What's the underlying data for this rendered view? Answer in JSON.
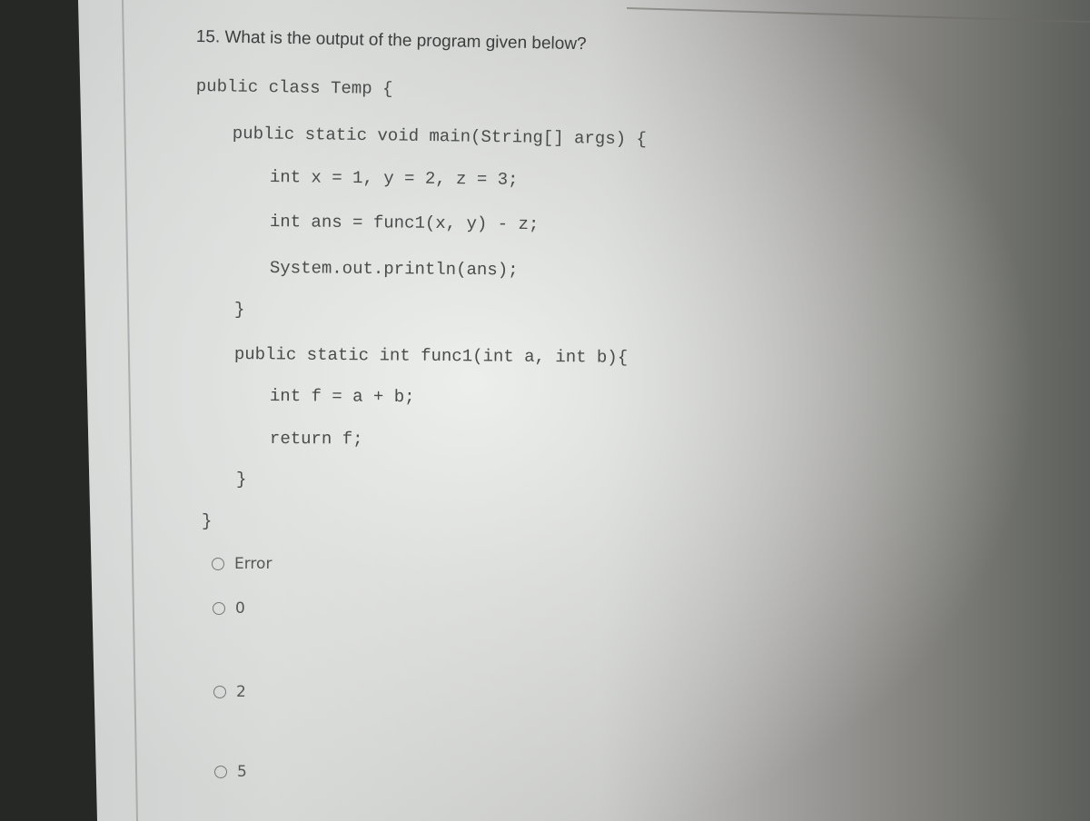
{
  "question": {
    "number": "15.",
    "text": "15. What is the output of the program given below?"
  },
  "code": {
    "lines": [
      "public class Temp {",
      "public static void main(String[] args) {",
      "int x = 1, y = 2, z = 3;",
      "int ans = func1(x, y) - z;",
      "System.out.println(ans);",
      "}",
      "public static int func1(int a, int b){",
      "int f = a + b;",
      "return f;",
      "}",
      "}"
    ]
  },
  "options": [
    {
      "label": "Error",
      "selected": false
    },
    {
      "label": "0",
      "selected": false
    },
    {
      "label": "2",
      "selected": false
    },
    {
      "label": "5",
      "selected": false
    }
  ]
}
